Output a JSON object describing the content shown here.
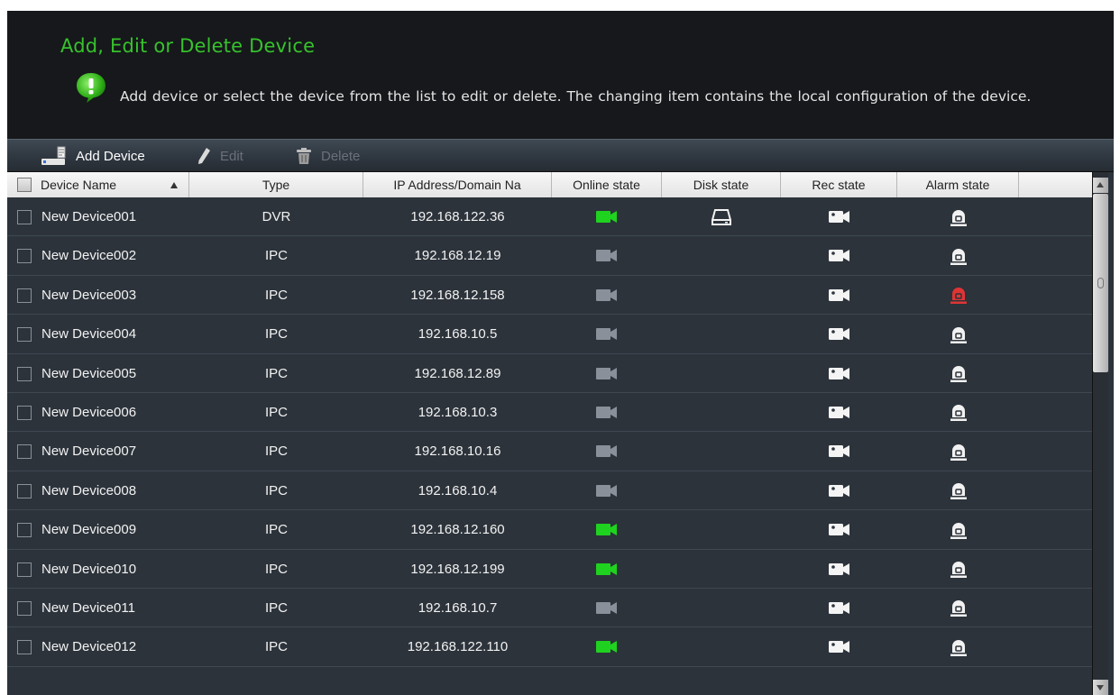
{
  "header": {
    "title": "Add, Edit or Delete Device",
    "description": "Add device or select the device from the list to edit or delete. The changing item contains the local configuration of the device.",
    "info_icon": "info-bubble-icon"
  },
  "toolbar": {
    "add_label": "Add Device",
    "edit_label": "Edit",
    "delete_label": "Delete"
  },
  "table": {
    "columns": {
      "name": "Device Name",
      "type": "Type",
      "ip": "IP Address/Domain Na",
      "online": "Online state",
      "disk": "Disk state",
      "rec": "Rec state",
      "alarm": "Alarm state"
    },
    "colors": {
      "online": "#1fd21f",
      "offline": "#8a9099",
      "alarm_active": "#e03434",
      "alarm_idle": "#f2f2f2"
    },
    "rows": [
      {
        "name": "New Device001",
        "type": "DVR",
        "ip": "192.168.122.36",
        "online": true,
        "disk": true,
        "alarm": false
      },
      {
        "name": "New Device002",
        "type": "IPC",
        "ip": "192.168.12.19",
        "online": false,
        "disk": false,
        "alarm": false
      },
      {
        "name": "New Device003",
        "type": "IPC",
        "ip": "192.168.12.158",
        "online": false,
        "disk": false,
        "alarm": true
      },
      {
        "name": "New Device004",
        "type": "IPC",
        "ip": "192.168.10.5",
        "online": false,
        "disk": false,
        "alarm": false
      },
      {
        "name": "New Device005",
        "type": "IPC",
        "ip": "192.168.12.89",
        "online": false,
        "disk": false,
        "alarm": false
      },
      {
        "name": "New Device006",
        "type": "IPC",
        "ip": "192.168.10.3",
        "online": false,
        "disk": false,
        "alarm": false
      },
      {
        "name": "New Device007",
        "type": "IPC",
        "ip": "192.168.10.16",
        "online": false,
        "disk": false,
        "alarm": false
      },
      {
        "name": "New Device008",
        "type": "IPC",
        "ip": "192.168.10.4",
        "online": false,
        "disk": false,
        "alarm": false
      },
      {
        "name": "New Device009",
        "type": "IPC",
        "ip": "192.168.12.160",
        "online": true,
        "disk": false,
        "alarm": false
      },
      {
        "name": "New Device010",
        "type": "IPC",
        "ip": "192.168.12.199",
        "online": true,
        "disk": false,
        "alarm": false
      },
      {
        "name": "New Device011",
        "type": "IPC",
        "ip": "192.168.10.7",
        "online": false,
        "disk": false,
        "alarm": false
      },
      {
        "name": "New Device012",
        "type": "IPC",
        "ip": "192.168.122.110",
        "online": true,
        "disk": false,
        "alarm": false
      }
    ]
  }
}
